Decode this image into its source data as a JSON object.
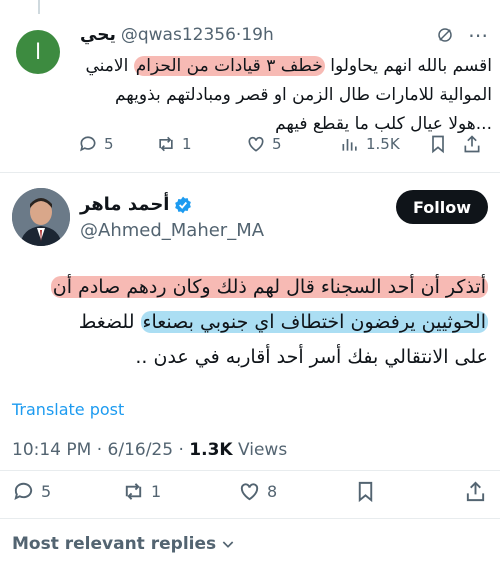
{
  "reply": {
    "avatar_letter": "ا",
    "display_name": "يحي",
    "handle": "@qwas12356",
    "time": "19h",
    "text_before": "اقسم بالله انهم يحاولوا ",
    "text_highlight": "خطف ٣ قيادات من الحزام",
    "text_after": " الامني الموالية للامارات طال الزمن او قصر ومبادلتهم بذويهم ...هولا عيال كلب ما يقطع فيهم",
    "replies": "5",
    "reposts": "1",
    "likes": "5",
    "views": "1.5K"
  },
  "main": {
    "display_name": "أحمد ماهر",
    "handle": "@Ahmed_Maher_MA",
    "follow_label": "Follow",
    "line1_highlight": "أتذكر أن أحد السجناء قال لهم ذلك وكان ردهم صادم أن",
    "line2_highlight": "الحوثيين يرفضون اختطاف اي جنوبي بصنعاء",
    "line2_rest": " للضغط",
    "line3": "على الانتقالي بفك أسر أحد أقاربه في عدن ..",
    "translate_label": "Translate post",
    "timestamp": "10:14 PM · 6/16/25 · ",
    "views_count": "1.3K",
    "views_label": " Views",
    "replies": "5",
    "reposts": "1",
    "likes": "8"
  },
  "footer": {
    "relevant_label": "Most relevant replies"
  },
  "colors": {
    "accent": "#1d9bf0",
    "highlight_red": "#f4a39b",
    "highlight_blue": "#96d6f0",
    "verified": "#1d9bf0"
  }
}
